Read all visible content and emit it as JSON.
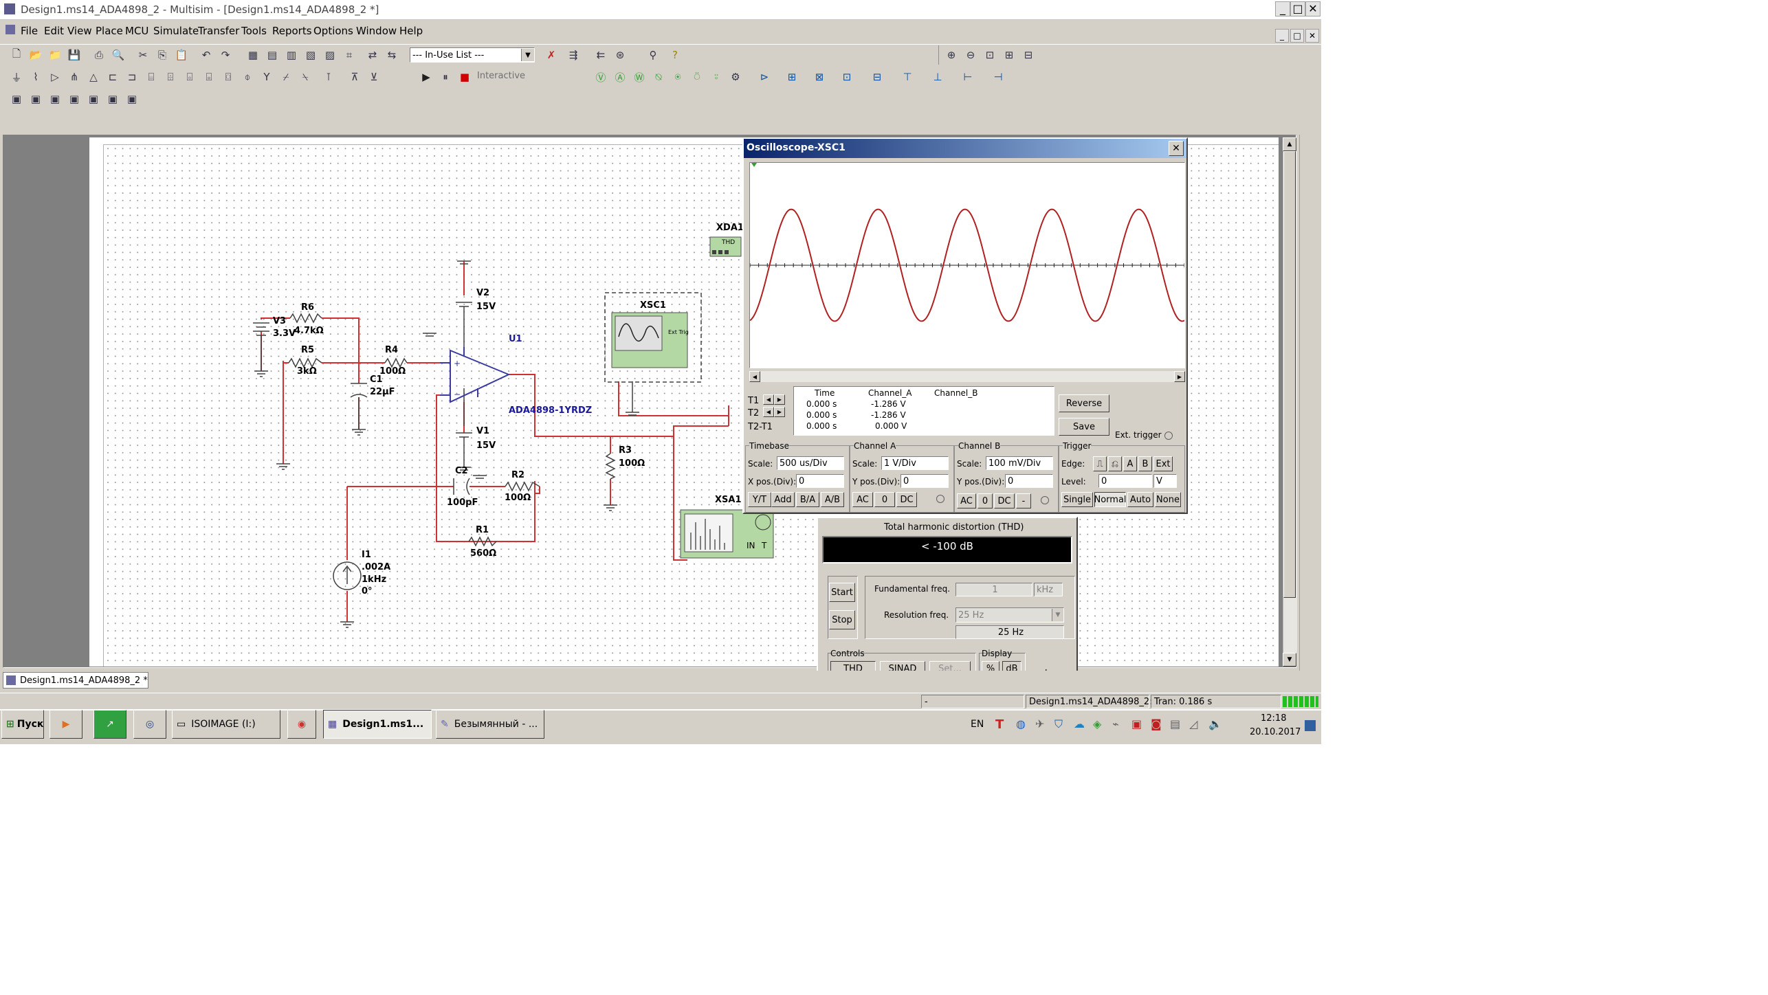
{
  "window": {
    "title": "Design1.ms14_ADA4898_2 - Multisim - [Design1.ms14_ADA4898_2 *]",
    "controls": [
      "_",
      "□",
      "X"
    ]
  },
  "menu": [
    "File",
    "Edit",
    "View",
    "Place",
    "MCU",
    "Simulate",
    "Transfer",
    "Tools",
    "Reports",
    "Options",
    "Window",
    "Help"
  ],
  "toolbar": {
    "in_use_list": "--- In-Use List ---",
    "interactive": "Interactive"
  },
  "schematic": {
    "components": {
      "v3": [
        "V3",
        "3.3V"
      ],
      "r6": [
        "R6",
        "4.7kΩ"
      ],
      "r5": [
        "R5",
        "3kΩ"
      ],
      "r4": [
        "R4",
        "100Ω"
      ],
      "c1": [
        "C1",
        "22µF"
      ],
      "v2": [
        "V2",
        "15V"
      ],
      "v1": [
        "V1",
        "15V"
      ],
      "u1": [
        "U1",
        "ADA4898-1YRDZ"
      ],
      "c2": [
        "C2",
        "100pF"
      ],
      "r2": [
        "R2",
        "100Ω"
      ],
      "r1": [
        "R1",
        "560Ω"
      ],
      "r3": [
        "R3",
        "100Ω"
      ],
      "i1": [
        "I1",
        ".002A",
        "1kHz",
        "0°"
      ],
      "xsc1": "XSC1",
      "xda1": "XDA1",
      "xsa1": "XSA1",
      "xsc1_ext": "Ext Trig",
      "thd_label": "THD",
      "xsa1_pins": [
        "IN",
        "T"
      ]
    },
    "tab": "Design1.ms14_ADA4898_2 *"
  },
  "oscilloscope": {
    "title": "Oscilloscope-XSC1",
    "readout": {
      "headers": [
        "Time",
        "Channel_A",
        "Channel_B"
      ],
      "rows": [
        {
          "label": "T1",
          "time": "0.000 s",
          "a": "-1.286 V",
          "b": ""
        },
        {
          "label": "T2",
          "time": "0.000 s",
          "a": "-1.286 V",
          "b": ""
        },
        {
          "label": "T2-T1",
          "time": "0.000 s",
          "a": "0.000 V",
          "b": ""
        }
      ]
    },
    "buttons": {
      "reverse": "Reverse",
      "save": "Save",
      "ext_trigger": "Ext. trigger"
    },
    "timebase": {
      "title": "Timebase",
      "scale_label": "Scale:",
      "scale": "500 us/Div",
      "xpos_label": "X pos.(Div):",
      "xpos": "0",
      "modes": [
        "Y/T",
        "Add",
        "B/A",
        "A/B"
      ]
    },
    "channel_a": {
      "title": "Channel A",
      "scale_label": "Scale:",
      "scale": "1 V/Div",
      "ypos_label": "Y pos.(Div):",
      "ypos": "0",
      "coupling": [
        "AC",
        "0",
        "DC"
      ]
    },
    "channel_b": {
      "title": "Channel B",
      "scale_label": "Scale:",
      "scale": "100 mV/Div",
      "ypos_label": "Y pos.(Div):",
      "ypos": "0",
      "coupling": [
        "AC",
        "0",
        "DC",
        "-"
      ]
    },
    "trigger": {
      "title": "Trigger",
      "edge_label": "Edge:",
      "sources": [
        "A",
        "B",
        "Ext"
      ],
      "level_label": "Level:",
      "level": "0",
      "unit": "V",
      "modes": [
        "Single",
        "Normal",
        "Auto",
        "None"
      ]
    },
    "waveform": {
      "amplitude_div": 1.286,
      "period_ms": 1.0,
      "cycles_shown": 5
    }
  },
  "distortion": {
    "header": "Total harmonic distortion (THD)",
    "value": "< -100 dB",
    "start": "Start",
    "stop": "Stop",
    "fund_label": "Fundamental freq.",
    "fund_value": "1",
    "fund_unit": "kHz",
    "res_label": "Resolution freq.",
    "res_value": "25 Hz",
    "res_display": "25 Hz",
    "controls_title": "Controls",
    "controls": [
      "THD",
      "SINAD",
      "Set..."
    ],
    "display_title": "Display",
    "display": [
      "%",
      "dB"
    ],
    "in_label": "In"
  },
  "statusbar": {
    "left": "-",
    "file": "Design1.ms14_ADA4898_2:",
    "tran": "Tran: 0.186 s"
  },
  "taskbar": {
    "start": "Пуск",
    "items": [
      "ISOIMAGE (I:)",
      "Design1.ms1...",
      "Безымянный - ..."
    ],
    "lang": "EN",
    "time": "12:18",
    "date": "20.10.2017"
  },
  "colors": {
    "wire": "#d03030",
    "trace": "#b02020",
    "label_blue": "#1a1a9a",
    "instrument_green": "#b4d8a4"
  }
}
